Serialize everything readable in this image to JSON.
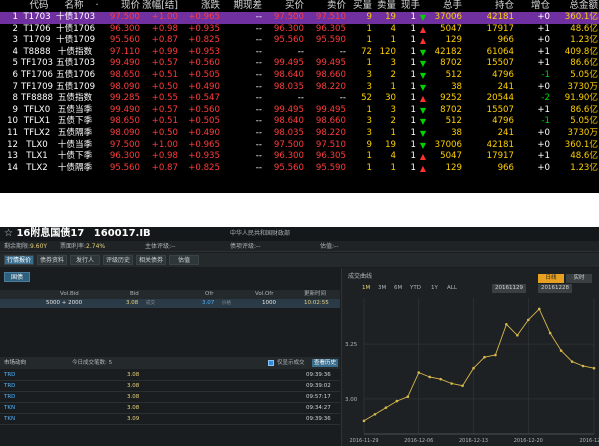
{
  "board": {
    "headers": [
      "代码",
      "名称",
      "·",
      "现价",
      "涨幅[结]",
      "涨跌",
      "期现差",
      "买价",
      "卖价",
      "买量",
      "卖量",
      "现手",
      "总手",
      "持仓",
      "增仓",
      "总金额"
    ],
    "rows": [
      {
        "num": "1",
        "code": "T1703",
        "name": "十债1703",
        "price": "97.500",
        "pct": "+1.00",
        "chg": "+0.965",
        "basis": "--",
        "bid": "97.500",
        "ask": "97.510",
        "bidv": "9",
        "askv": "19",
        "hand": "1",
        "dir": "down",
        "vol": "37006",
        "oi": "42181",
        "oic": "+0",
        "amt": "360.1亿",
        "color": "red",
        "selected": true
      },
      {
        "num": "2",
        "code": "T1706",
        "name": "十债1706",
        "price": "96.300",
        "pct": "+0.98",
        "chg": "+0.935",
        "basis": "--",
        "bid": "96.300",
        "ask": "96.305",
        "bidv": "1",
        "askv": "4",
        "hand": "1",
        "dir": "up",
        "vol": "5047",
        "oi": "17917",
        "oic": "+1",
        "amt": "48.6亿",
        "color": "red",
        "selected": false
      },
      {
        "num": "3",
        "code": "T1709",
        "name": "十债1709",
        "price": "95.560",
        "pct": "+0.87",
        "chg": "+0.825",
        "basis": "--",
        "bid": "95.560",
        "ask": "95.590",
        "bidv": "1",
        "askv": "1",
        "hand": "1",
        "dir": "up",
        "vol": "129",
        "oi": "966",
        "oic": "+0",
        "amt": "1.23亿",
        "color": "red",
        "selected": false
      },
      {
        "num": "4",
        "code": "T8888",
        "name": "十债指数",
        "price": "97.110",
        "pct": "+0.99",
        "chg": "+0.953",
        "basis": "--",
        "bid": "--",
        "ask": "--",
        "bidv": "72",
        "askv": "120",
        "hand": "1",
        "dir": "down",
        "vol": "42182",
        "oi": "61064",
        "oic": "+1",
        "amt": "409.8亿",
        "color": "red",
        "selected": false
      },
      {
        "num": "5",
        "code": "TF1703",
        "name": "五债1703",
        "price": "99.490",
        "pct": "+0.57",
        "chg": "+0.560",
        "basis": "--",
        "bid": "99.495",
        "ask": "99.495",
        "bidv": "1",
        "askv": "3",
        "hand": "1",
        "dir": "down",
        "vol": "8702",
        "oi": "15507",
        "oic": "+1",
        "amt": "86.6亿",
        "color": "red",
        "selected": false
      },
      {
        "num": "6",
        "code": "TF1706",
        "name": "五债1706",
        "price": "98.650",
        "pct": "+0.51",
        "chg": "+0.505",
        "basis": "--",
        "bid": "98.640",
        "ask": "98.660",
        "bidv": "3",
        "askv": "2",
        "hand": "1",
        "dir": "down",
        "vol": "512",
        "oi": "4796",
        "oic": "-1",
        "amt": "5.05亿",
        "color": "red",
        "selected": false
      },
      {
        "num": "7",
        "code": "TF1709",
        "name": "五债1709",
        "price": "98.090",
        "pct": "+0.50",
        "chg": "+0.490",
        "basis": "--",
        "bid": "98.035",
        "ask": "98.220",
        "bidv": "3",
        "askv": "1",
        "hand": "1",
        "dir": "down",
        "vol": "38",
        "oi": "241",
        "oic": "+0",
        "amt": "3730万",
        "color": "red",
        "selected": false
      },
      {
        "num": "8",
        "code": "TF8888",
        "name": "五债指数",
        "price": "99.285",
        "pct": "+0.55",
        "chg": "+0.547",
        "basis": "--",
        "bid": "--",
        "ask": "--",
        "bidv": "52",
        "askv": "30",
        "hand": "1",
        "dir": "up",
        "vol": "9252",
        "oi": "20544",
        "oic": "-2",
        "amt": "91.90亿",
        "color": "red",
        "selected": false
      },
      {
        "num": "9",
        "code": "TFLX0",
        "name": "五债当季",
        "price": "99.490",
        "pct": "+0.57",
        "chg": "+0.560",
        "basis": "--",
        "bid": "99.495",
        "ask": "99.495",
        "bidv": "1",
        "askv": "3",
        "hand": "1",
        "dir": "down",
        "vol": "8702",
        "oi": "15507",
        "oic": "+1",
        "amt": "86.6亿",
        "color": "red",
        "selected": false
      },
      {
        "num": "10",
        "code": "TFLX1",
        "name": "五债下季",
        "price": "98.650",
        "pct": "+0.51",
        "chg": "+0.505",
        "basis": "--",
        "bid": "98.640",
        "ask": "98.660",
        "bidv": "3",
        "askv": "2",
        "hand": "1",
        "dir": "down",
        "vol": "512",
        "oi": "4796",
        "oic": "-1",
        "amt": "5.05亿",
        "color": "red",
        "selected": false
      },
      {
        "num": "11",
        "code": "TFLX2",
        "name": "五债隔季",
        "price": "98.090",
        "pct": "+0.50",
        "chg": "+0.490",
        "basis": "--",
        "bid": "98.035",
        "ask": "98.220",
        "bidv": "3",
        "askv": "1",
        "hand": "1",
        "dir": "down",
        "vol": "38",
        "oi": "241",
        "oic": "+0",
        "amt": "3730万",
        "color": "red",
        "selected": false
      },
      {
        "num": "12",
        "code": "TLX0",
        "name": "十债当季",
        "price": "97.500",
        "pct": "+1.00",
        "chg": "+0.965",
        "basis": "--",
        "bid": "97.500",
        "ask": "97.510",
        "bidv": "9",
        "askv": "19",
        "hand": "1",
        "dir": "down",
        "vol": "37006",
        "oi": "42181",
        "oic": "+0",
        "amt": "360.1亿",
        "color": "red",
        "selected": false
      },
      {
        "num": "13",
        "code": "TLX1",
        "name": "十债下季",
        "price": "96.300",
        "pct": "+0.98",
        "chg": "+0.935",
        "basis": "--",
        "bid": "96.300",
        "ask": "96.305",
        "bidv": "1",
        "askv": "4",
        "hand": "1",
        "dir": "up",
        "vol": "5047",
        "oi": "17917",
        "oic": "+1",
        "amt": "48.6亿",
        "color": "red",
        "selected": false
      },
      {
        "num": "14",
        "code": "TLX2",
        "name": "十债隔季",
        "price": "95.560",
        "pct": "+0.87",
        "chg": "+0.825",
        "basis": "--",
        "bid": "95.560",
        "ask": "95.590",
        "bidv": "1",
        "askv": "1",
        "hand": "1",
        "dir": "up",
        "vol": "129",
        "oi": "966",
        "oic": "+0",
        "amt": "1.23亿",
        "color": "red",
        "selected": false
      }
    ]
  },
  "bond": {
    "star": "☆",
    "title": "16附息国债17",
    "code": "160017.IB",
    "issuer": "中华人民共和国财政部",
    "info": {
      "term_label": "剩余期限:",
      "term_value": "9.60Y",
      "coupon_label": "票面利率:",
      "coupon_value": "2.74%",
      "rating_label": "主体评级:",
      "rating_value": "--",
      "debt_rating_label": "债项评级:",
      "debt_rating_value": "--",
      "valuation_label": "估值:",
      "valuation_value": "--"
    },
    "tabs": [
      "行情报价",
      "债券资料",
      "发行人",
      "评级历史",
      "相关债券",
      "估值"
    ],
    "refresh_label": "国债",
    "quote_headers": {
      "vol_bid": "Vol.Bid",
      "bid": "Bid",
      "ofr": "Ofr",
      "vol_ofr": "Vol.Ofr",
      "time": "更新时间"
    },
    "quote": {
      "vol_bid": "5000 + 2000",
      "bid": "3.08",
      "bid_sub": "成交",
      "ofr": "3.07",
      "ofr_sub": "价格",
      "vol_ofr": "1000",
      "time": "10:02:55"
    },
    "deal_bar": {
      "title": "市场动向",
      "turnover": "今日成交笔数: 5",
      "show_all": "仅显示成交",
      "history": "查看历史"
    },
    "deals": [
      {
        "tag": "TRD",
        "value": "3.08",
        "time": "09:39:36"
      },
      {
        "tag": "TRD",
        "value": "3.08",
        "time": "09:39:02"
      },
      {
        "tag": "TRD",
        "value": "3.08",
        "time": "09:57:17"
      },
      {
        "tag": "TKN",
        "value": "3.08",
        "time": "09:34:27"
      },
      {
        "tag": "TKN",
        "value": "3.09",
        "time": "09:39:36"
      }
    ],
    "chart_panel": {
      "title": "成交曲线",
      "mode_day": "日线",
      "mode_live": "实时",
      "ranges": [
        "1M",
        "3M",
        "6M",
        "YTD",
        "1Y",
        "ALL"
      ],
      "active_range": "1M",
      "date_from": "20161129",
      "date_to": "20161228"
    }
  },
  "chart_data": {
    "type": "line",
    "title": "成交曲线",
    "xlabel": "",
    "ylabel": "",
    "x": [
      "2016-11-29",
      "2016-11-30",
      "2016-12-01",
      "2016-12-02",
      "2016-12-05",
      "2016-12-06",
      "2016-12-07",
      "2016-12-08",
      "2016-12-09",
      "2016-12-12",
      "2016-12-13",
      "2016-12-14",
      "2016-12-15",
      "2016-12-16",
      "2016-12-19",
      "2016-12-20",
      "2016-12-21",
      "2016-12-22",
      "2016-12-23",
      "2016-12-26",
      "2016-12-27",
      "2016-12-28"
    ],
    "y": [
      2.9,
      2.93,
      2.96,
      2.99,
      3.01,
      3.12,
      3.1,
      3.09,
      3.07,
      3.06,
      3.14,
      3.19,
      3.2,
      3.34,
      3.29,
      3.36,
      3.41,
      3.3,
      3.22,
      3.17,
      3.15,
      3.14
    ],
    "xticks": [
      "2016-11-29",
      "2016-12-06",
      "2016-12-13",
      "2016-12-20",
      "2016-12-28"
    ],
    "yticks": [
      "3.00",
      "3.25"
    ],
    "ylim": [
      2.84,
      3.46
    ],
    "grid": true,
    "color": "#d8b84a"
  },
  "colors": {
    "accent": "#3a6d8c",
    "selected_row": "#7030a0",
    "up": "#ff3c3c",
    "down": "#00d400"
  }
}
